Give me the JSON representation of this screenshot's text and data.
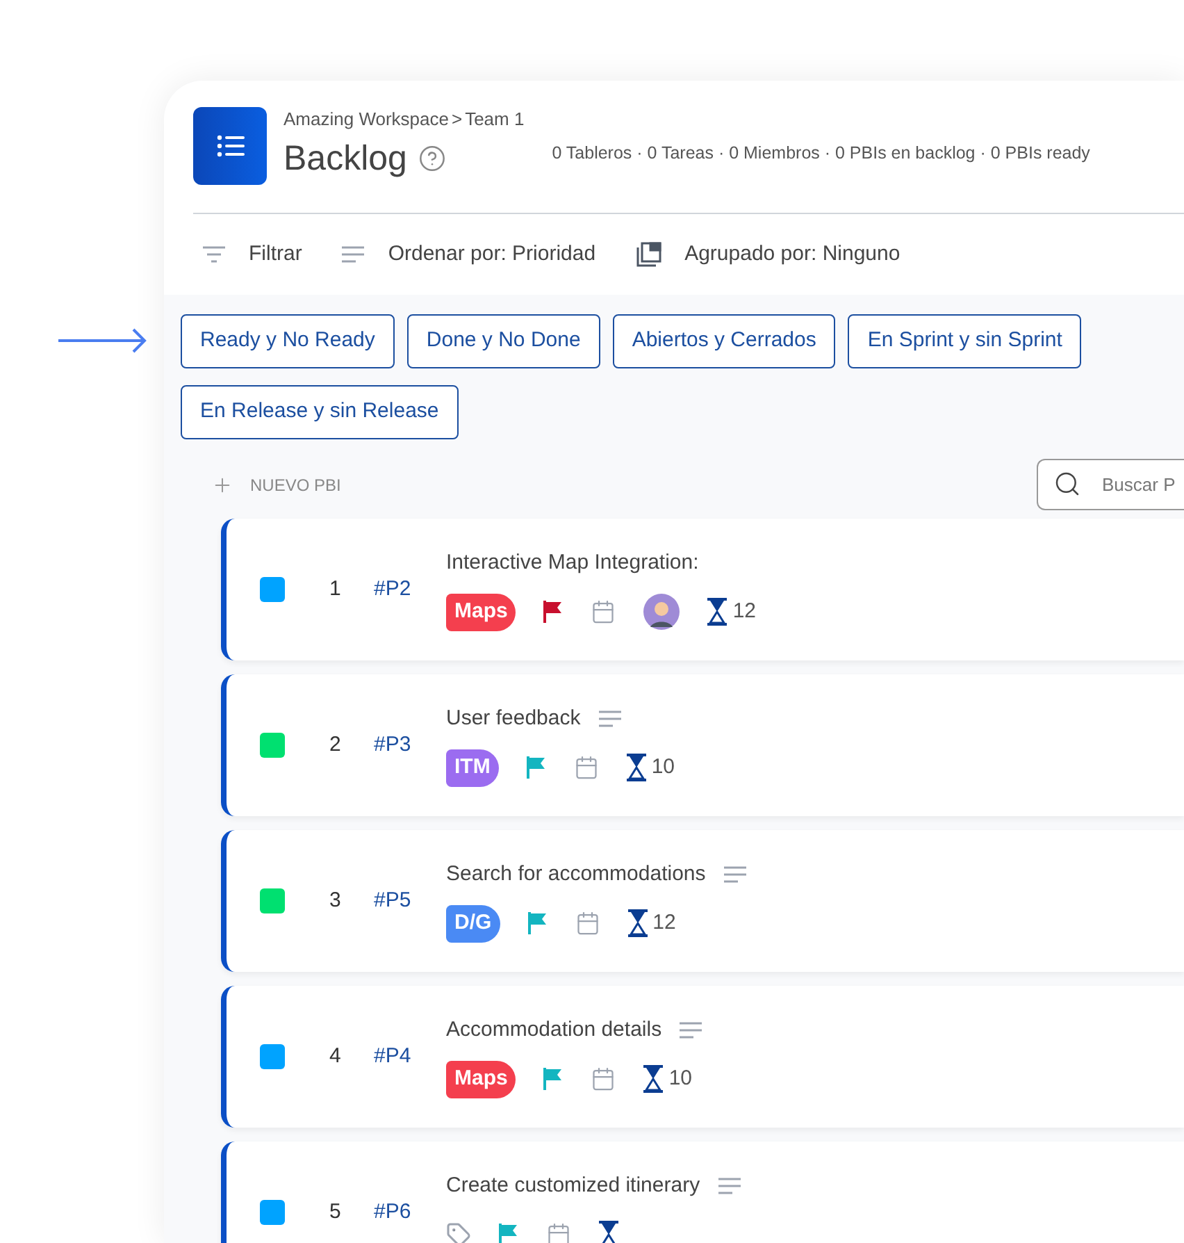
{
  "breadcrumb": {
    "workspace": "Amazing Workspace",
    "separator": ">",
    "team": "Team 1"
  },
  "title": "Backlog",
  "stats": "0 Tableros · 0 Tareas · 0 Miembros · 0 PBIs en backlog · 0 PBIs ready",
  "toolbar": [
    "Filtrar",
    "Ordenar por: Prioridad",
    "Agrupado por: Ninguno"
  ],
  "filter_chips": [
    "Ready y No Ready",
    "Done y No Done",
    "Abiertos y Cerrados",
    "En Sprint y sin Sprint",
    "En Release y sin Release"
  ],
  "new_button": "NUEVO PBI",
  "search": {
    "placeholder": "Buscar P"
  },
  "rows": [
    {
      "number": "1",
      "code": "#P2",
      "title": "Interactive Map Integration:",
      "status": {
        "color": "#00a3ff"
      },
      "has_description": false,
      "tag": {
        "label": "Maps",
        "color": "#f43f4e"
      },
      "flag": {
        "color": "#c8102e"
      },
      "avatar": true,
      "estimate": "12"
    },
    {
      "number": "2",
      "code": "#P3",
      "title": "User feedback",
      "status": {
        "color": "#00e070"
      },
      "has_description": true,
      "tag": {
        "label": "ITM",
        "color": "#9b6cf0"
      },
      "flag": {
        "color": "#13b5c0"
      },
      "avatar": false,
      "estimate": "10"
    },
    {
      "number": "3",
      "code": "#P5",
      "title": "Search for accommodations",
      "status": {
        "color": "#00e070"
      },
      "has_description": true,
      "tag": {
        "label": "D/G",
        "color": "#4a8af4"
      },
      "flag": {
        "color": "#13b5c0"
      },
      "avatar": false,
      "estimate": "12"
    },
    {
      "number": "4",
      "code": "#P4",
      "title": "Accommodation details",
      "status": {
        "color": "#00a3ff"
      },
      "has_description": true,
      "tag": {
        "label": "Maps",
        "color": "#f43f4e"
      },
      "flag": {
        "color": "#13b5c0"
      },
      "avatar": false,
      "estimate": "10"
    },
    {
      "number": "5",
      "code": "#P6",
      "title": "Create customized itinerary",
      "status": {
        "color": "#00a3ff"
      },
      "has_description": true,
      "flag": {
        "color": "#13b5c0"
      },
      "avatar": false
    }
  ]
}
